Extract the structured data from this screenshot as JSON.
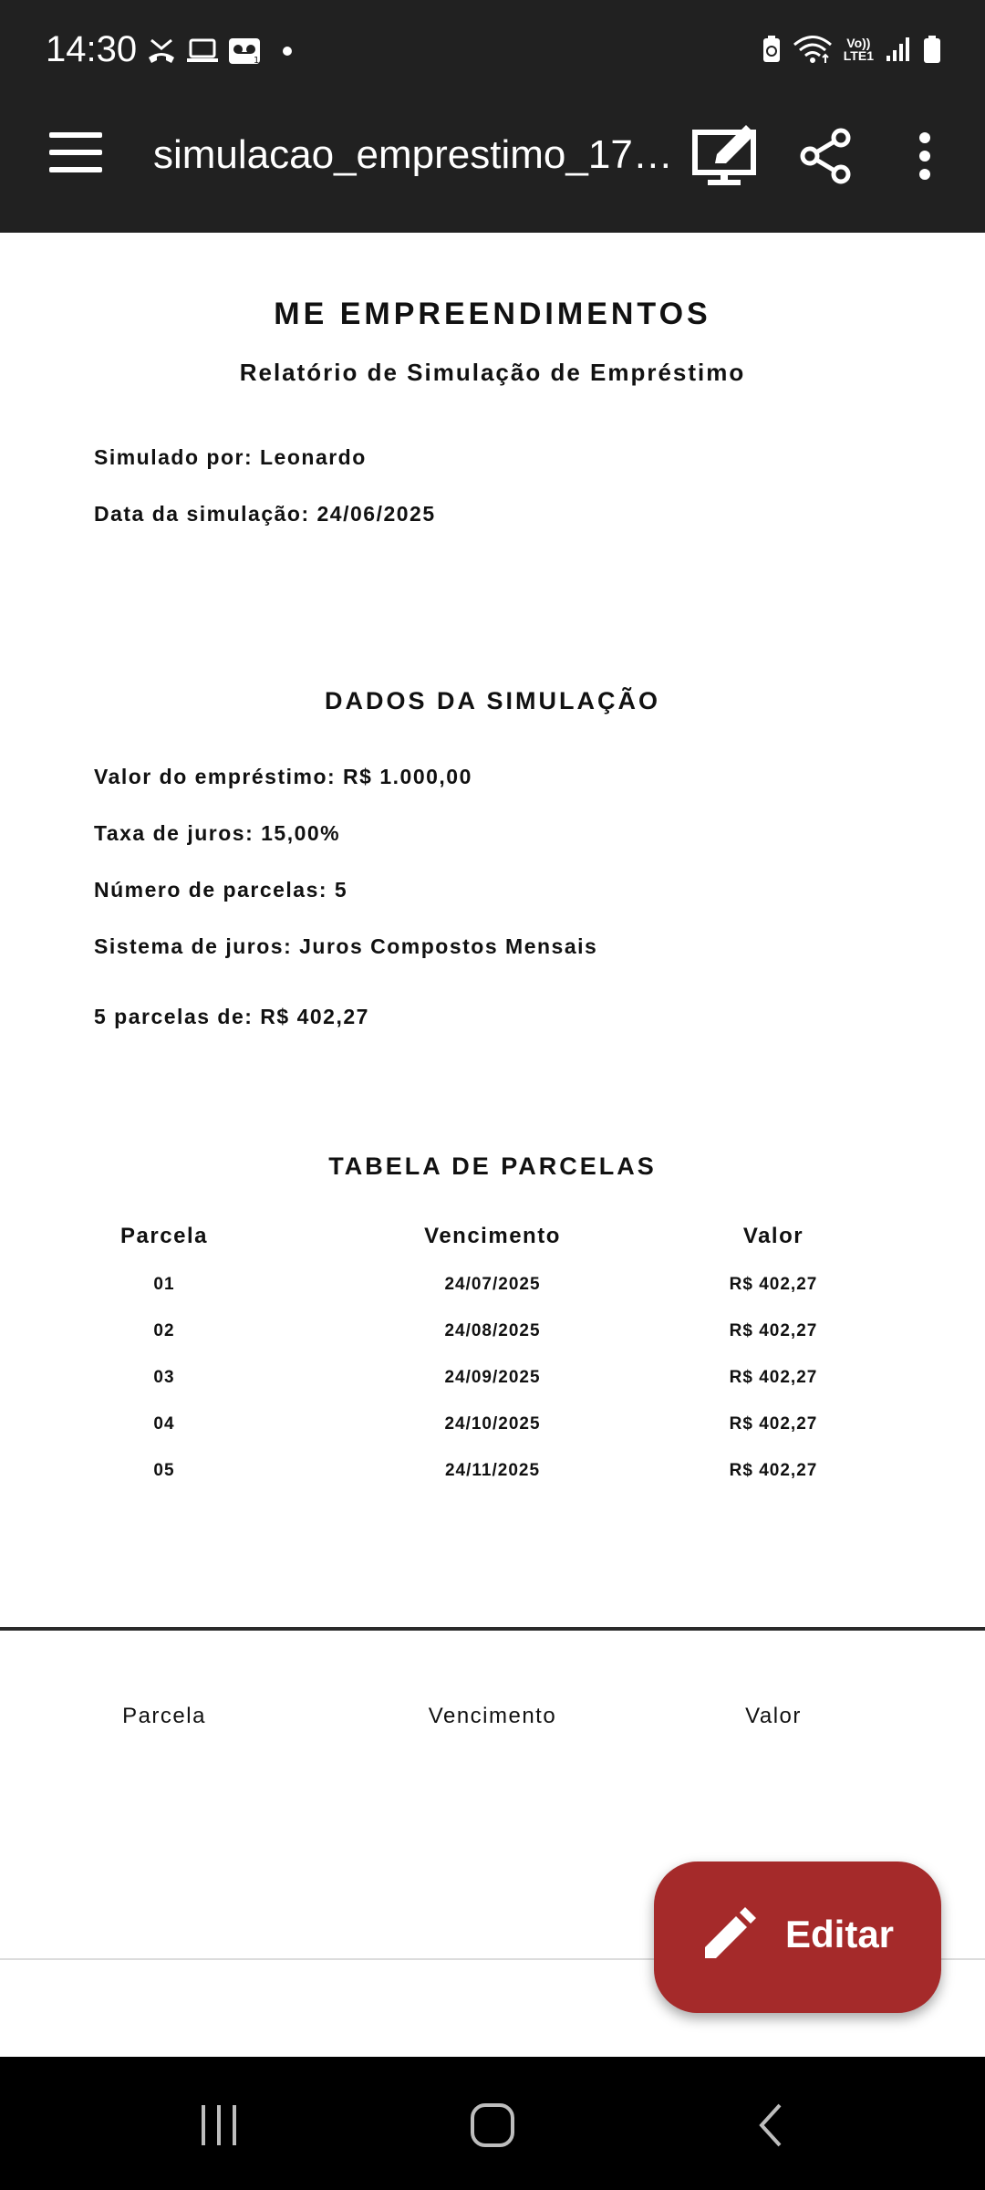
{
  "status_bar": {
    "time": "14:30",
    "left_icons": [
      "missed-call-icon",
      "laptop-icon",
      "voicemail-icon",
      "dot-icon"
    ],
    "right_icons": [
      "battery-saver-icon",
      "wifi-icon",
      "volte-lte-icon",
      "signal-icon",
      "battery-icon"
    ],
    "volte_label": "Vo))",
    "lte_label": "LTE1"
  },
  "app_bar": {
    "title": "simulacao_emprestimo_175…",
    "icons": [
      "menu-icon",
      "edit-screen-icon",
      "share-icon",
      "more-vert-icon"
    ]
  },
  "document": {
    "company": "ME EMPREENDIMENTOS",
    "report_title": "Relatório de Simulação de Empréstimo",
    "simulated_by": "Simulado por: Leonardo",
    "simulation_date": "Data da simulação: 24/06/2025",
    "section_data_title": "DADOS DA SIMULAÇÃO",
    "loan_value": "Valor do empréstimo: R$ 1.000,00",
    "interest_rate": "Taxa de juros: 15,00%",
    "installments_count": "Número de parcelas: 5",
    "interest_system": "Sistema de juros: Juros Compostos Mensais",
    "installments_summary": "5 parcelas de: R$ 402,27",
    "section_table_title": "TABELA DE PARCELAS",
    "table_headers": [
      "Parcela",
      "Vencimento",
      "Valor"
    ],
    "table_rows": [
      [
        "01",
        "24/07/2025",
        "R$ 402,27"
      ],
      [
        "02",
        "24/08/2025",
        "R$ 402,27"
      ],
      [
        "03",
        "24/09/2025",
        "R$ 402,27"
      ],
      [
        "04",
        "24/10/2025",
        "R$ 402,27"
      ],
      [
        "05",
        "24/11/2025",
        "R$ 402,27"
      ]
    ],
    "page2_headers": [
      "Parcela",
      "Vencimento",
      "Valor"
    ]
  },
  "fab": {
    "label": "Editar",
    "icon": "pencil-icon",
    "color": "#a52a2a"
  },
  "nav_bar": {
    "icons": [
      "recents-icon",
      "home-icon",
      "back-icon"
    ]
  },
  "colors": {
    "bar_background": "#212121",
    "page_background": "#ffffff",
    "nav_background": "#000000"
  }
}
